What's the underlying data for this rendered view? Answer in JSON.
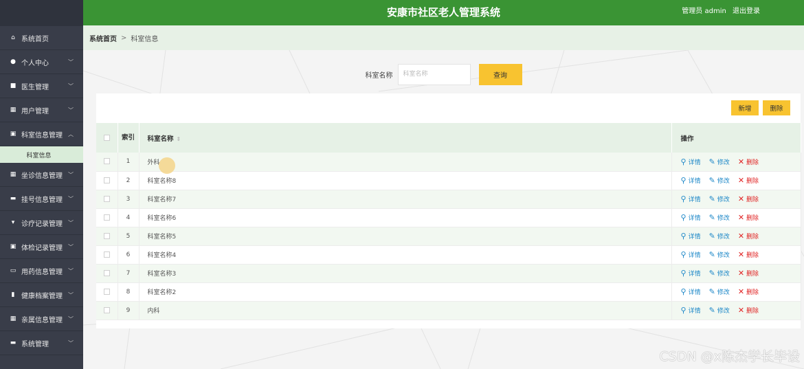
{
  "app": {
    "title": "安康市社区老人管理系统",
    "user_label": "管理员 admin",
    "logout_label": "退出登录"
  },
  "sidebar": {
    "items": [
      {
        "label": "系统首页",
        "icon": "home-icon",
        "chevron": false
      },
      {
        "label": "个人中心",
        "icon": "person-icon",
        "chevron": true
      },
      {
        "label": "医生管理",
        "icon": "briefcase-icon",
        "chevron": true
      },
      {
        "label": "用户管理",
        "icon": "grid-icon",
        "chevron": true
      },
      {
        "label": "科室信息管理",
        "icon": "clipboard-icon",
        "chevron": true,
        "expanded": true
      },
      {
        "label": "坐诊信息管理",
        "icon": "grid-icon",
        "chevron": true
      },
      {
        "label": "挂号信息管理",
        "icon": "monitor-icon",
        "chevron": true
      },
      {
        "label": "诊疗记录管理",
        "icon": "comment-icon",
        "chevron": true
      },
      {
        "label": "体检记录管理",
        "icon": "clipboard-icon",
        "chevron": true
      },
      {
        "label": "用药信息管理",
        "icon": "ticket-icon",
        "chevron": true
      },
      {
        "label": "健康档案管理",
        "icon": "book-icon",
        "chevron": true
      },
      {
        "label": "亲属信息管理",
        "icon": "grid-icon",
        "chevron": true
      },
      {
        "label": "系统管理",
        "icon": "chat-icon",
        "chevron": true
      }
    ],
    "sub_item": "科室信息"
  },
  "breadcrumb": {
    "home": "系统首页",
    "separator": ">",
    "current": "科室信息"
  },
  "search": {
    "label": "科室名称",
    "placeholder": "科室名称",
    "button": "查询"
  },
  "actions": {
    "add": "新增",
    "delete": "删除"
  },
  "table": {
    "headers": {
      "index": "索引",
      "name": "科室名称",
      "ops": "操作"
    },
    "rows": [
      {
        "index": "1",
        "name": "外科"
      },
      {
        "index": "2",
        "name": "科室名称8"
      },
      {
        "index": "3",
        "name": "科室名称7"
      },
      {
        "index": "4",
        "name": "科室名称6"
      },
      {
        "index": "5",
        "name": "科室名称5"
      },
      {
        "index": "6",
        "name": "科室名称4"
      },
      {
        "index": "7",
        "name": "科室名称3"
      },
      {
        "index": "8",
        "name": "科室名称2"
      },
      {
        "index": "9",
        "name": "内科"
      }
    ],
    "op_labels": {
      "detail": "详情",
      "edit": "修改",
      "delete": "删除"
    }
  },
  "watermark": "CSDN @x陈杰学长毕设",
  "colors": {
    "header_green": "#3a9434",
    "sidebar_dark": "#393d49",
    "button_yellow": "#f8c330",
    "row_tint": "#f2f8f1",
    "delete_red": "#e02424",
    "link_blue": "#1e88c8"
  }
}
